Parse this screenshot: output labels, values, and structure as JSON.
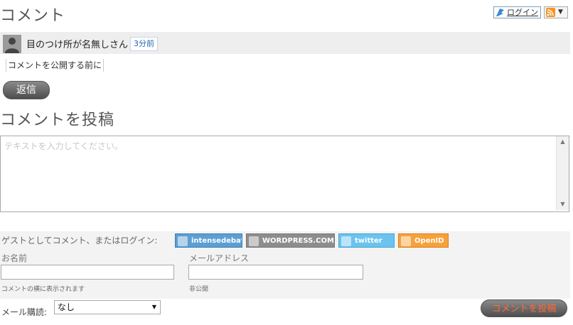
{
  "comments_heading": "コメント",
  "header": {
    "login_label": "ログイン",
    "rss_icon": "rss-icon",
    "dropdown_icon": "chevron-down-icon"
  },
  "comment": {
    "author": "目のつけ所が名無しさん",
    "time": "3分前",
    "body": "コメントを公開する前に",
    "reply_label": "返信"
  },
  "post_heading": "コメントを投稿",
  "editor": {
    "placeholder": "テキストを入力してください。"
  },
  "guest": {
    "label": "ゲストとしてコメント、またはログイン:",
    "services": [
      {
        "label": "intensedebate",
        "color": "#5b9fd4"
      },
      {
        "label": "WORDPRESS.COM",
        "color": "#8d8d8d"
      },
      {
        "label": "twitter",
        "color": "#6bc3ef"
      },
      {
        "label": "OpenID",
        "color": "#f7a13a"
      }
    ],
    "name_label": "お名前",
    "name_hint": "コメントの横に表示されます",
    "email_label": "メールアドレス",
    "email_hint": "非公開"
  },
  "subscribe": {
    "label": "メール購読:",
    "selected": "なし"
  },
  "post_button": "コメントを投稿",
  "colors": {
    "accent": "#ff6a3a",
    "button_dark": "#4d4d4d"
  }
}
